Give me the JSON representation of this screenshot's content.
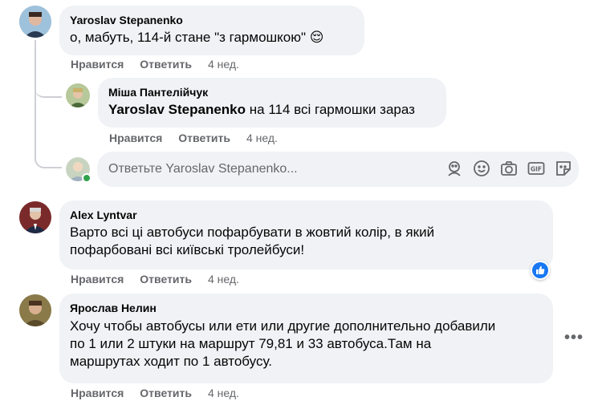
{
  "comments": [
    {
      "author": "Yaroslav Stepanenko",
      "text": "о, мабуть, 114-й стане \"з гармошкою\"",
      "emoji": "😌",
      "like": "Нравится",
      "reply": "Ответить",
      "time": "4 нед."
    },
    {
      "author": "Alex Lyntvar",
      "text_line1": "Варто всі ці автобуси пофарбувати в жовтий колір, в який",
      "text_line2": "пофарбовані всі київські тролейбуси!",
      "like": "Нравится",
      "reply": "Ответить",
      "time": "4 нед."
    },
    {
      "author": "Ярослав Нелин",
      "text_line1": "Хочу чтобы автобусы или ети или другие дополнительно добавили",
      "text_line2": "по 1 или 2 штуки на маршрут 79,81 и 33 автобуса.Там на",
      "text_line3": "маршрутах ходит по 1 автобусу.",
      "like": "Нравится",
      "reply": "Ответить",
      "time": "4 нед."
    }
  ],
  "reply_comment": {
    "author": "Міша Пантелійчук",
    "mention": "Yaroslav Stepanenko",
    "text": " на 114 всі гармошки зараз",
    "like": "Нравится",
    "reply": "Ответить",
    "time": "4 нед."
  },
  "reply_input": {
    "placeholder": "Ответьте Yaroslav Stepanenko..."
  },
  "more_label": "•••",
  "colors": {
    "bubble": "#f0f2f5",
    "secondary_text": "#65676b",
    "like_blue": "#1877f2",
    "online_green": "#31a24c"
  }
}
